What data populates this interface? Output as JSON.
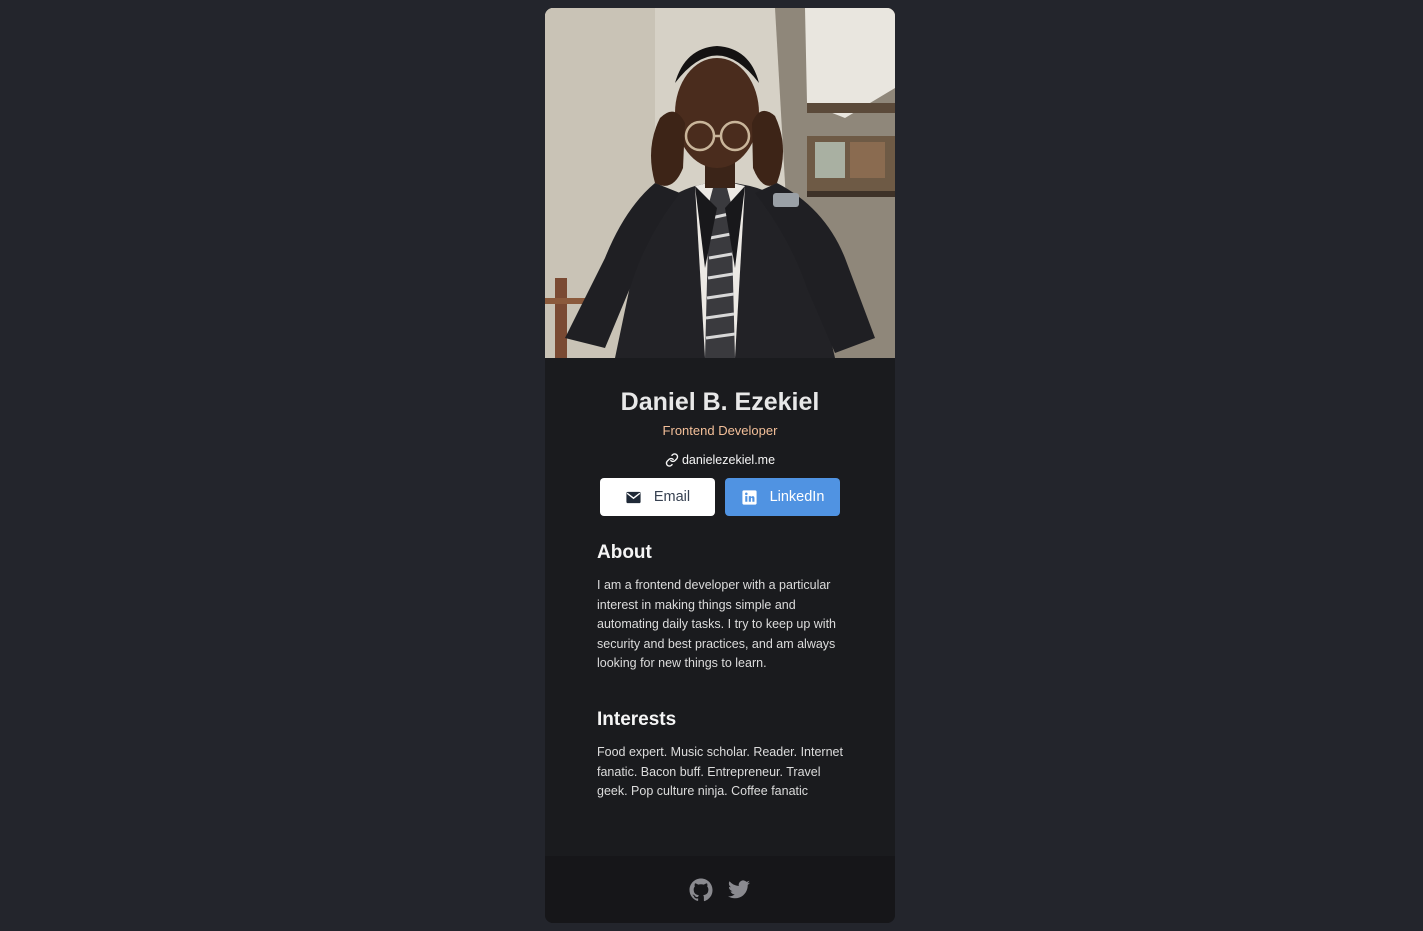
{
  "profile": {
    "name": "Daniel B. Ezekiel",
    "role": "Frontend Developer",
    "website": "danielezekiel.me"
  },
  "buttons": {
    "email": "Email",
    "linkedin": "LinkedIn"
  },
  "about": {
    "heading": "About",
    "text": "I am a frontend developer with a particular interest in making things simple and automating daily tasks. I try to keep up with security and best practices, and am always looking for new things to learn."
  },
  "interests": {
    "heading": "Interests",
    "text": "Food expert. Music scholar. Reader. Internet fanatic. Bacon buff. Entrepreneur. Travel geek. Pop culture ninja. Coffee fanatic"
  },
  "footer": {
    "icons": [
      "github-icon",
      "twitter-icon"
    ]
  },
  "colors": {
    "page_background": "#23252c",
    "card_background": "#1a1b1e",
    "footer_background": "#161619",
    "role_accent": "#f3bf99",
    "linkedin_blue": "#5093e2"
  }
}
